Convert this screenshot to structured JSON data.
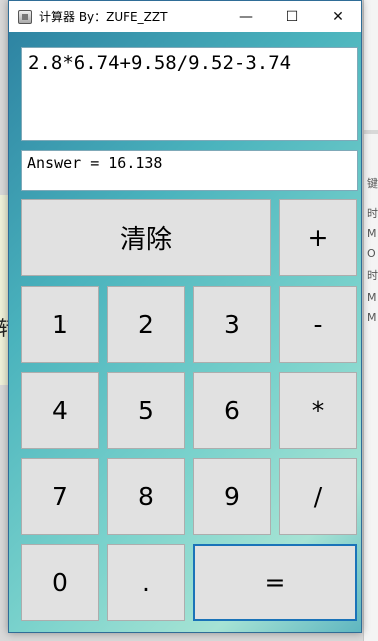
{
  "window": {
    "title": "计算器 By：ZUFE_ZZT",
    "minimize_glyph": "—",
    "maximize_glyph": "☐",
    "close_glyph": "✕"
  },
  "display": {
    "expression": "2.8*6.74+9.58/9.52-3.74",
    "answer": "Answer = 16.138"
  },
  "buttons": {
    "clear": "清除",
    "plus": "+",
    "minus": "-",
    "multiply": "*",
    "divide": "/",
    "equals": "=",
    "dot": ".",
    "d0": "0",
    "d1": "1",
    "d2": "2",
    "d3": "3",
    "d4": "4",
    "d5": "5",
    "d6": "6",
    "d7": "7",
    "d8": "8",
    "d9": "9"
  },
  "background": {
    "left_text": "转",
    "right_texts": [
      "键",
      "时",
      "M",
      "O",
      "时",
      "M",
      "M"
    ]
  },
  "colors": {
    "window_border": "#2f6d97",
    "button_face": "#e1e1e1",
    "focus_border": "#1a73b8"
  }
}
